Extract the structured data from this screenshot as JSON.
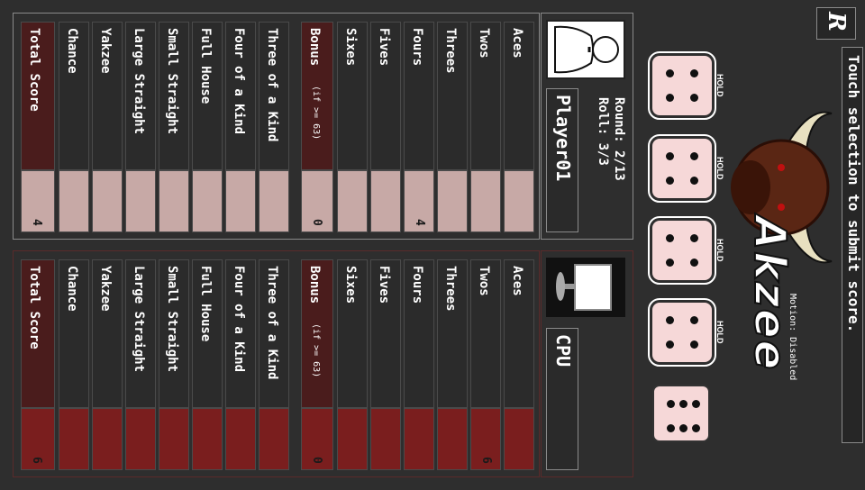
{
  "quit_button": {
    "label": "R"
  },
  "instructions": "Touch selection to submit score.",
  "logo": {
    "title": "Akzee"
  },
  "motion_status": "Motion: Disabled",
  "round_info": {
    "round": "Round: 2/13",
    "roll": "Roll: 3/3"
  },
  "dice": [
    {
      "value": 4,
      "label": "HOLD",
      "held": true
    },
    {
      "value": 4,
      "label": "HOLD",
      "held": true
    },
    {
      "value": 4,
      "label": "HOLD",
      "held": true
    },
    {
      "value": 4,
      "label": "HOLD",
      "held": true
    },
    {
      "value": 6,
      "label": "",
      "held": false
    }
  ],
  "player1": {
    "name": "Player01",
    "avatar_icon": "person-icon",
    "rows": [
      {
        "label": "Aces",
        "score": ""
      },
      {
        "label": "Twos",
        "score": ""
      },
      {
        "label": "Threes",
        "score": ""
      },
      {
        "label": "Fours",
        "score": "4"
      },
      {
        "label": "Fives",
        "score": ""
      },
      {
        "label": "Sixes",
        "score": ""
      },
      {
        "label": "Bonus",
        "label_note": "(if >= 63)",
        "score": "0"
      },
      {
        "label": "Three of a Kind",
        "score": ""
      },
      {
        "label": "Four of a Kind",
        "score": ""
      },
      {
        "label": "Full House",
        "score": ""
      },
      {
        "label": "Small Straight",
        "score": ""
      },
      {
        "label": "Large Straight",
        "score": ""
      },
      {
        "label": "Yakzee",
        "score": ""
      },
      {
        "label": "Chance",
        "score": ""
      },
      {
        "label": "Total Score",
        "score": "4"
      }
    ]
  },
  "cpu": {
    "name": "CPU",
    "avatar_icon": "computer-icon",
    "rows": [
      {
        "label": "Aces",
        "score": ""
      },
      {
        "label": "Twos",
        "score": "6"
      },
      {
        "label": "Threes",
        "score": ""
      },
      {
        "label": "Fours",
        "score": ""
      },
      {
        "label": "Fives",
        "score": ""
      },
      {
        "label": "Sixes",
        "score": ""
      },
      {
        "label": "Bonus",
        "label_note": "(if >= 63)",
        "score": "0"
      },
      {
        "label": "Three of a Kind",
        "score": ""
      },
      {
        "label": "Four of a Kind",
        "score": ""
      },
      {
        "label": "Full House",
        "score": ""
      },
      {
        "label": "Small Straight",
        "score": ""
      },
      {
        "label": "Large Straight",
        "score": ""
      },
      {
        "label": "Yakzee",
        "score": ""
      },
      {
        "label": "Chance",
        "score": ""
      },
      {
        "label": "Total Score",
        "score": "6"
      }
    ]
  }
}
